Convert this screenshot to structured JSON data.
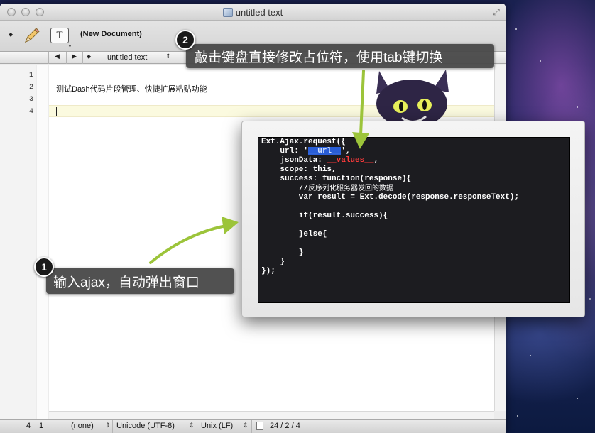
{
  "window": {
    "title": "untitled text"
  },
  "toolbar": {
    "document_label": "(New Document)",
    "textbox_glyph": "T"
  },
  "navbar": {
    "doc_name": "untitled text"
  },
  "editor": {
    "line_numbers": [
      "1",
      "2",
      "3",
      "4"
    ],
    "line2_text": "测试Dash代码片段管理、快捷扩展粘贴功能"
  },
  "statusbar": {
    "line": "4",
    "column": "1",
    "language": "(none)",
    "encoding": "Unicode (UTF-8)",
    "line_endings": "Unix (LF)",
    "stats": "24 / 2 / 4"
  },
  "annotations": {
    "step1": {
      "number": "1",
      "text": "输入ajax，自动弹出窗口"
    },
    "step2": {
      "number": "2",
      "text": "敲击键盘直接修改占位符，使用tab键切换"
    }
  },
  "snippet": {
    "line1": "Ext.Ajax.request({",
    "line2_prefix": "    url: '",
    "line2_placeholder": "__url__",
    "line2_suffix": "',",
    "line3_prefix": "    jsonData: ",
    "line3_placeholder": "__values__",
    "line3_suffix": ",",
    "line4": "    scope: this,",
    "line5": "    success: function(response){",
    "line6_comment_prefix": "        //",
    "line6_comment_text": "反序列化服务器发回的数据",
    "line7": "        var result = Ext.decode(response.responseText);",
    "line8": "",
    "line9": "        if(result.success){",
    "line10": "",
    "line11": "        }else{",
    "line12": "",
    "line13": "        }",
    "line14": "    }",
    "line15": "});"
  },
  "colors": {
    "placeholder_selected": "#2a5ed6",
    "placeholder_red": "#ff3b3b",
    "arrow_green": "#9cc43a",
    "current_line": "#fbfadf"
  }
}
